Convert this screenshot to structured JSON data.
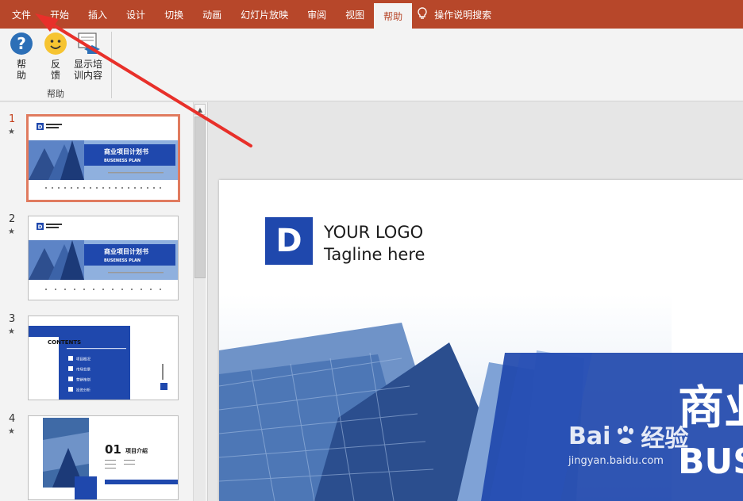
{
  "tabs": [
    "文件",
    "开始",
    "插入",
    "设计",
    "切换",
    "动画",
    "幻灯片放映",
    "审阅",
    "视图",
    "帮助"
  ],
  "active_tab_index": 9,
  "tell_me": {
    "icon": "lightbulb-icon",
    "label": "操作说明搜索"
  },
  "ribbon": {
    "help_label": "帮\n助",
    "feedback_label": "反\n馈",
    "training_label": "显示培\n训内容",
    "group_label": "帮助"
  },
  "slides": [
    {
      "number": "1",
      "title": "商业项目计划书",
      "subtitle": "BUSENESS PLAN"
    },
    {
      "number": "2",
      "title": "商业项目计划书",
      "subtitle": "BUSENESS PLAN"
    },
    {
      "number": "3",
      "title": "CONTENTS",
      "items": [
        "项目概况",
        "市场背景",
        "营销策划",
        "投资分析"
      ]
    },
    {
      "number": "4",
      "title": "01",
      "subtitle": "项目介绍"
    }
  ],
  "main_slide": {
    "logo_letter": "D",
    "logo_line1": "YOUR LOGO",
    "logo_line2": "Tagline here",
    "title_partial": "商业",
    "subtitle_partial": "BUS"
  },
  "watermark": {
    "brand": "Bai",
    "brand2": "经验",
    "url": "jingyan.baidu.com"
  },
  "colors": {
    "accent": "#b7472a",
    "slide_blue": "#1f48ad",
    "selection": "#e07b5f"
  }
}
